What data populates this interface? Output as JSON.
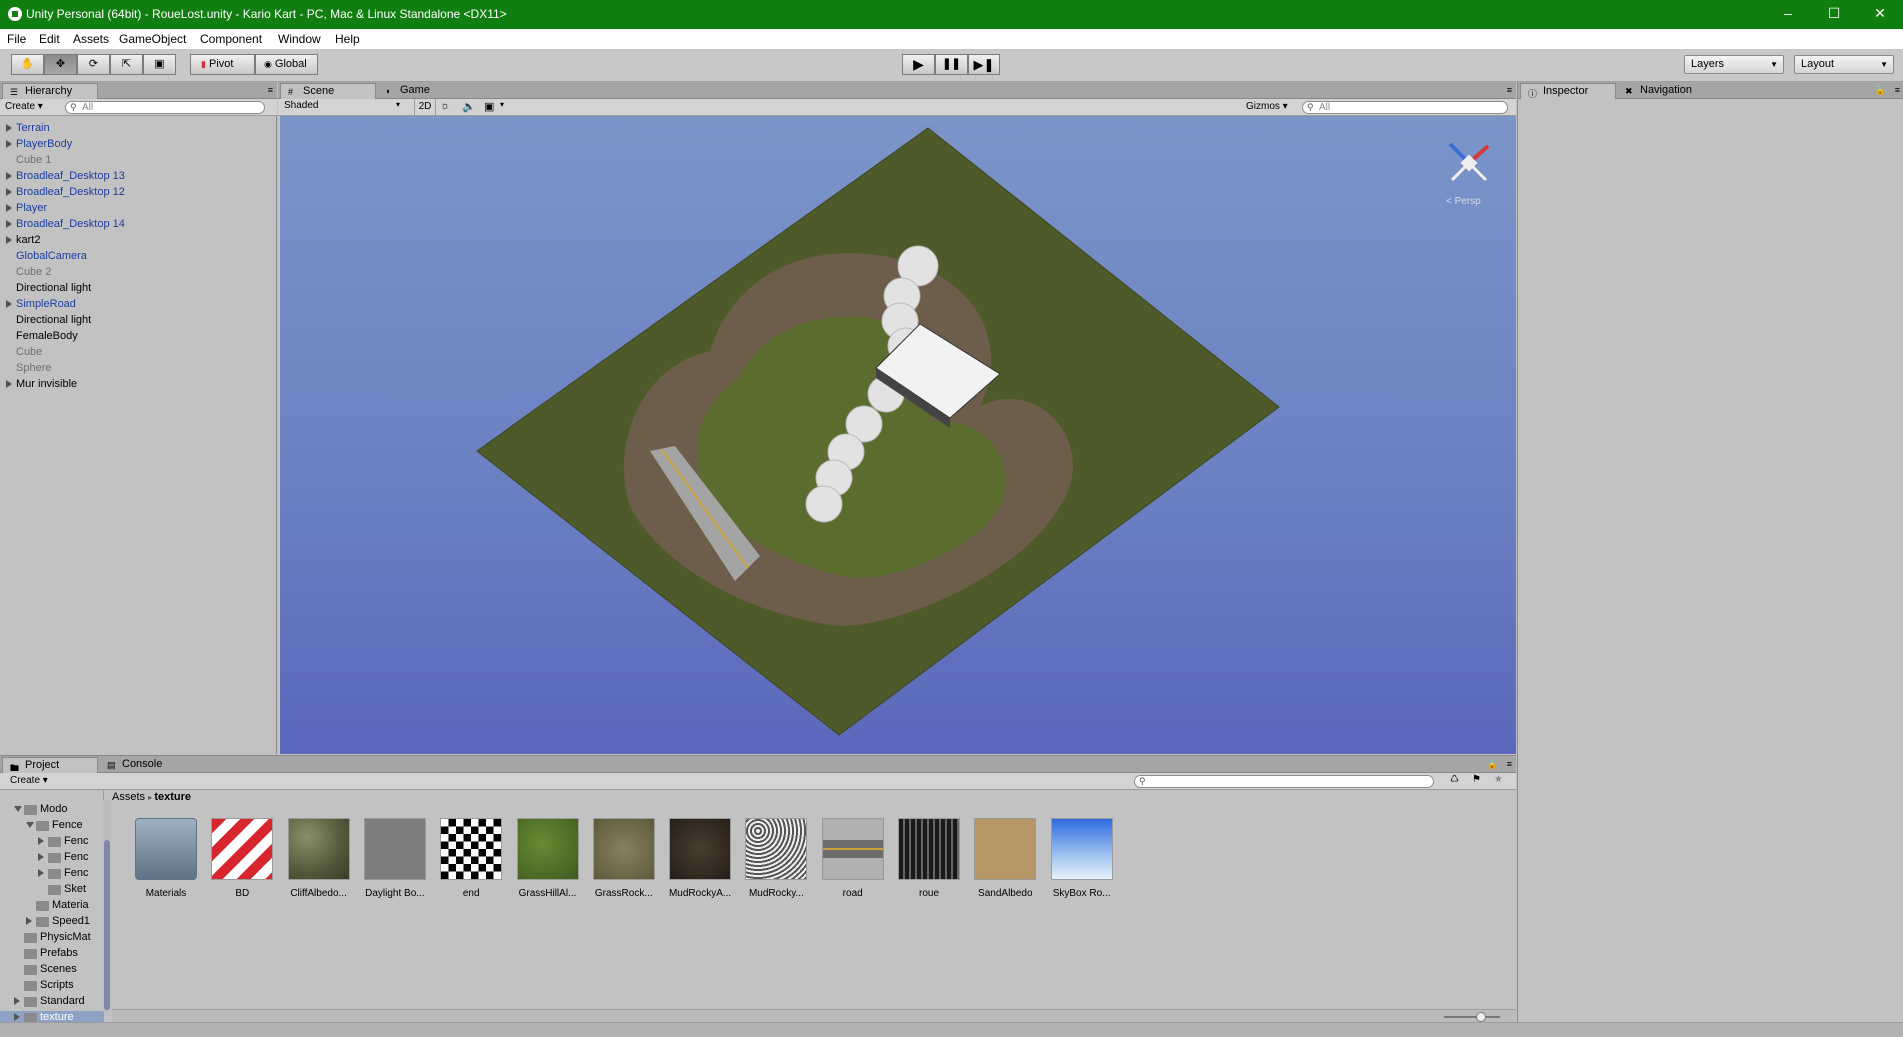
{
  "window": {
    "title": "Unity Personal (64bit) - RoueLost.unity - Kario Kart - PC, Mac & Linux Standalone <DX11>",
    "controls": [
      "minimize-icon",
      "maximize-icon",
      "close-icon"
    ]
  },
  "menu": [
    "File",
    "Edit",
    "Assets",
    "GameObject",
    "Component",
    "Window",
    "Help"
  ],
  "toolbar": {
    "tools": [
      "hand-icon",
      "move-icon",
      "rotate-icon",
      "scale-icon",
      "rect-icon"
    ],
    "pivot_label": "Pivot",
    "global_label": "Global",
    "play_controls": [
      "play-icon",
      "pause-icon",
      "step-icon"
    ],
    "layers_label": "Layers",
    "layout_label": "Layout"
  },
  "hierarchy": {
    "tab_label": "Hierarchy",
    "create_label": "Create",
    "search_placeholder": "All",
    "items": [
      {
        "label": "Terrain",
        "color": "blue",
        "foldable": true
      },
      {
        "label": "PlayerBody",
        "color": "blue",
        "foldable": true
      },
      {
        "label": "Cube 1",
        "color": "gray",
        "foldable": false
      },
      {
        "label": "Broadleaf_Desktop 13",
        "color": "blue",
        "foldable": true
      },
      {
        "label": "Broadleaf_Desktop 12",
        "color": "blue",
        "foldable": true
      },
      {
        "label": "Player",
        "color": "blue",
        "foldable": true
      },
      {
        "label": "Broadleaf_Desktop 14",
        "color": "blue",
        "foldable": true
      },
      {
        "label": "kart2",
        "color": "black",
        "foldable": true
      },
      {
        "label": "GlobalCamera",
        "color": "blue",
        "foldable": false
      },
      {
        "label": "Cube 2",
        "color": "gray",
        "foldable": false
      },
      {
        "label": "Directional light",
        "color": "black",
        "foldable": false
      },
      {
        "label": "SimpleRoad",
        "color": "blue",
        "foldable": true
      },
      {
        "label": "Directional light",
        "color": "black",
        "foldable": false
      },
      {
        "label": "FemaleBody",
        "color": "black",
        "foldable": false
      },
      {
        "label": "Cube",
        "color": "gray",
        "foldable": false
      },
      {
        "label": "Sphere",
        "color": "gray",
        "foldable": false
      },
      {
        "label": "Mur invisible",
        "color": "black",
        "foldable": true
      }
    ]
  },
  "scene": {
    "tab_scene": "Scene",
    "tab_game": "Game",
    "shading_mode": "Shaded",
    "mode_2d": "2D",
    "gizmos_label": "Gizmos",
    "search_placeholder": "All",
    "persp_label": "< Persp"
  },
  "inspector": {
    "tab_inspector": "Inspector",
    "tab_navigation": "Navigation"
  },
  "project": {
    "tab_project": "Project",
    "tab_console": "Console",
    "create_label": "Create",
    "breadcrumb": [
      "Assets",
      "texture"
    ],
    "tree": [
      {
        "label": "Modo",
        "indent": 1,
        "open": true
      },
      {
        "label": "Fence",
        "indent": 2,
        "open": true
      },
      {
        "label": "Fenc",
        "indent": 3,
        "open": false
      },
      {
        "label": "Fenc",
        "indent": 3,
        "open": false
      },
      {
        "label": "Fenc",
        "indent": 3,
        "open": false
      },
      {
        "label": "Sket",
        "indent": 3,
        "open": null
      },
      {
        "label": "Materia",
        "indent": 2,
        "open": null
      },
      {
        "label": "Speed1",
        "indent": 2,
        "open": false
      },
      {
        "label": "PhysicMat",
        "indent": 1,
        "open": null
      },
      {
        "label": "Prefabs",
        "indent": 1,
        "open": null
      },
      {
        "label": "Scenes",
        "indent": 1,
        "open": null
      },
      {
        "label": "Scripts",
        "indent": 1,
        "open": null
      },
      {
        "label": "Standard",
        "indent": 1,
        "open": false
      },
      {
        "label": "texture",
        "indent": 1,
        "open": false,
        "selected": true
      }
    ],
    "assets": [
      {
        "label": "Materials",
        "kind": "folder"
      },
      {
        "label": "BD",
        "kind": "stripes"
      },
      {
        "label": "CliffAlbedo...",
        "kind": "cliff"
      },
      {
        "label": "Daylight Bo...",
        "kind": "gray"
      },
      {
        "label": "end",
        "kind": "checker"
      },
      {
        "label": "GrassHillAl...",
        "kind": "grass"
      },
      {
        "label": "GrassRock...",
        "kind": "grassrock"
      },
      {
        "label": "MudRockyA...",
        "kind": "mud"
      },
      {
        "label": "MudRocky...",
        "kind": "noise"
      },
      {
        "label": "road",
        "kind": "road"
      },
      {
        "label": "roue",
        "kind": "tire"
      },
      {
        "label": "SandAlbedo",
        "kind": "sand"
      },
      {
        "label": "SkyBox Ro...",
        "kind": "sky"
      }
    ]
  }
}
